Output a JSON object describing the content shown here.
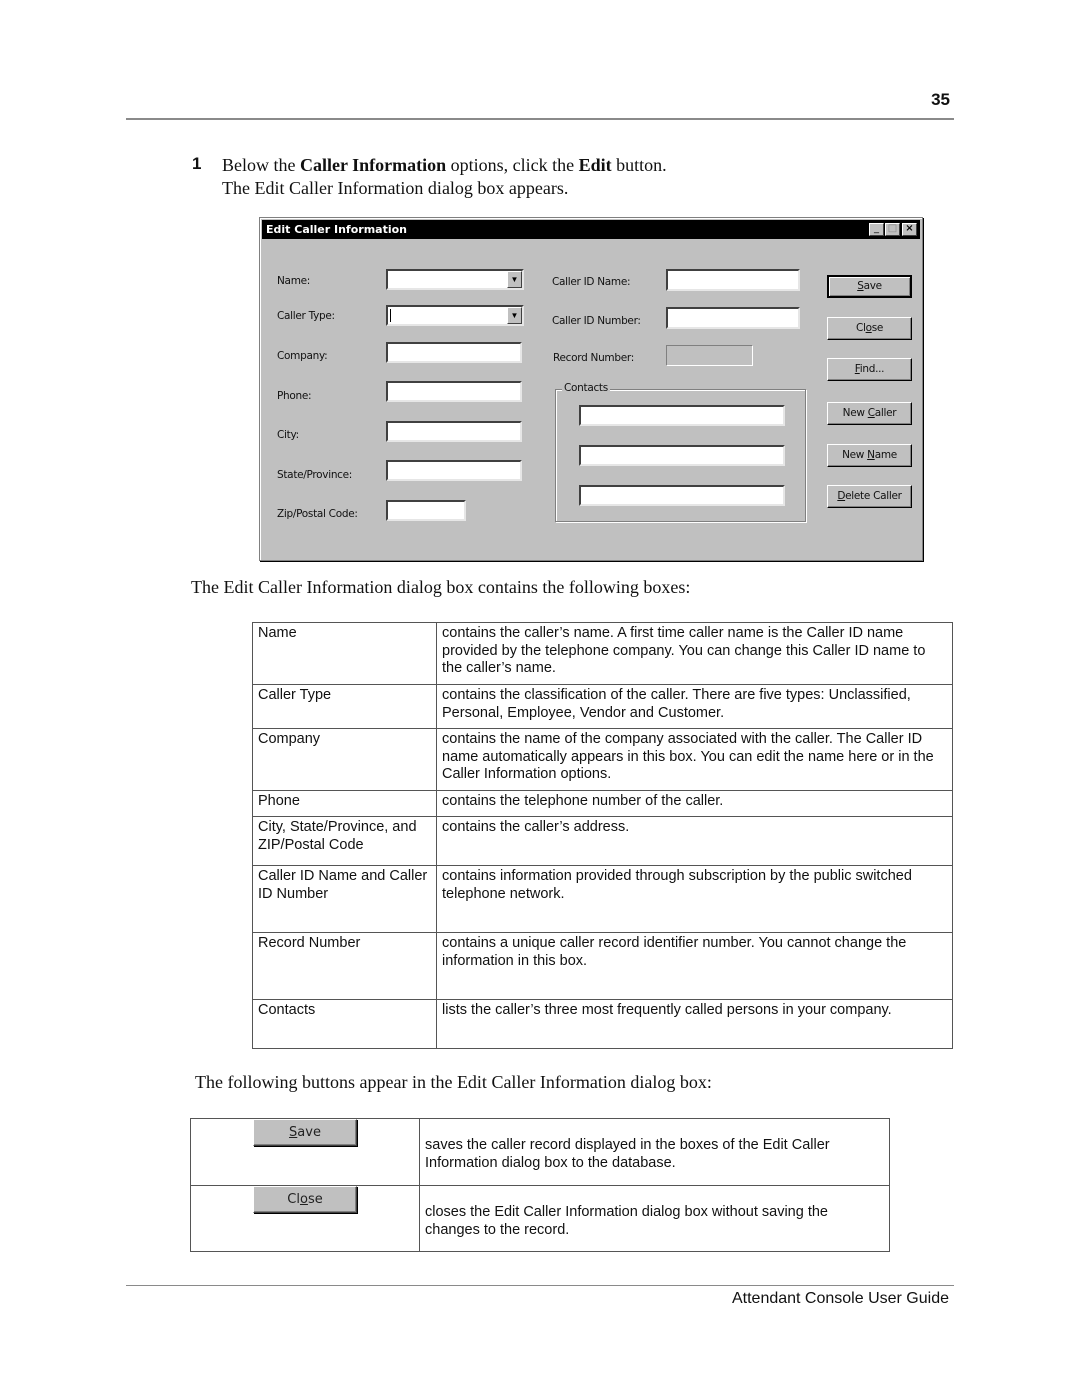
{
  "header": {
    "page_number": "35"
  },
  "step": {
    "number": "1",
    "line1_pre": "Below the ",
    "line1_bold1": "Caller Information",
    "line1_mid": " options, click the ",
    "line1_bold2": "Edit",
    "line1_post": " button.",
    "line2": "The Edit Caller Information dialog box appears."
  },
  "dialog": {
    "title": "Edit Caller Information",
    "window_controls": {
      "minimize": "_",
      "maximize": "□",
      "close": "×"
    },
    "left_fields": [
      {
        "label": "Name:",
        "type": "combo",
        "value": ""
      },
      {
        "label": "Caller Type:",
        "type": "combo",
        "value": ""
      },
      {
        "label": "Company:",
        "type": "text",
        "value": ""
      },
      {
        "label": "Phone:",
        "type": "text",
        "value": ""
      },
      {
        "label": "City:",
        "type": "text",
        "value": ""
      },
      {
        "label": "State/Province:",
        "type": "text",
        "value": ""
      },
      {
        "label": "Zip/Postal Code:",
        "type": "text",
        "value": ""
      }
    ],
    "right_fields": [
      {
        "label": "Caller ID Name:",
        "value": ""
      },
      {
        "label": "Caller ID Number:",
        "value": ""
      },
      {
        "label": "Record Number:",
        "value": "",
        "disabled": true
      }
    ],
    "contacts": {
      "title": "Contacts",
      "values": [
        "",
        "",
        ""
      ]
    },
    "buttons": [
      {
        "pre": "",
        "key": "S",
        "post": "ave"
      },
      {
        "pre": "Cl",
        "key": "o",
        "post": "se"
      },
      {
        "pre": "",
        "key": "F",
        "post": "ind..."
      },
      {
        "pre": "New ",
        "key": "C",
        "post": "aller"
      },
      {
        "pre": "New ",
        "key": "N",
        "post": "ame"
      },
      {
        "pre": "",
        "key": "D",
        "post": "elete Caller"
      }
    ]
  },
  "boxes_intro": "The Edit Caller Information dialog box contains the following boxes:",
  "boxes_table": [
    {
      "field": "Name",
      "description": "contains the caller’s name. A first time caller name is the Caller ID name provided by the telephone company. You can change this Caller ID name to the caller’s name."
    },
    {
      "field": "Caller Type",
      "description": "contains the classification of the caller. There are five types: Unclassified, Personal, Employee, Vendor and Customer."
    },
    {
      "field": "Company",
      "description": "contains the name of the company associated with the caller. The Caller ID name automatically appears in this box. You can edit the name here or in the Caller Information options."
    },
    {
      "field": "Phone",
      "description": "contains the telephone number of the caller."
    },
    {
      "field": "City, State/Province, and ZIP/Postal Code",
      "description": "contains the caller’s address."
    },
    {
      "field": "Caller ID Name and Caller ID Number",
      "description": "contains information provided through subscription by the public switched telephone network."
    },
    {
      "field": "Record Number",
      "description": "contains a unique caller record identifier number. You cannot change the information in this box."
    },
    {
      "field": "Contacts",
      "description": "lists the caller’s three most frequently called persons in your company."
    }
  ],
  "buttons_intro": "The following buttons appear in the Edit Caller Information dialog box:",
  "buttons_table": [
    {
      "button": {
        "pre": "",
        "key": "S",
        "post": "ave"
      },
      "description": "saves the caller record displayed in the boxes of the Edit Caller Information dialog box to the database."
    },
    {
      "button": {
        "pre": "Cl",
        "key": "o",
        "post": "se"
      },
      "description": "closes the Edit Caller Information dialog box without saving the changes to the record."
    }
  ],
  "footer": {
    "title": "Attendant Console User Guide"
  }
}
